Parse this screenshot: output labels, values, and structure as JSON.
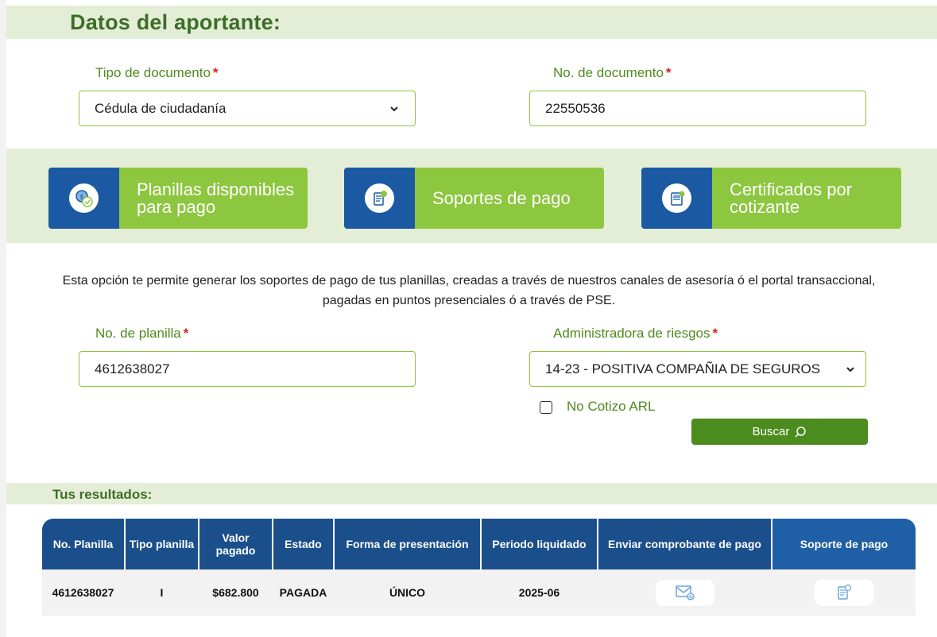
{
  "section_title": "Datos del aportante:",
  "doc_type": {
    "label": "Tipo de documento",
    "required": "*",
    "value": "Cédula de ciudadanía"
  },
  "doc_number": {
    "label": "No. de documento",
    "required": "*",
    "value": "22550536"
  },
  "options": [
    {
      "label": "Planillas disponibles para pago",
      "icon": "money-check-icon"
    },
    {
      "label": "Soportes de pago",
      "icon": "receipt-icon"
    },
    {
      "label": "Certificados por cotizante",
      "icon": "certificate-icon"
    }
  ],
  "description": "Esta opción te permite generar los soportes de pago de tus planillas, creadas a través de nuestros canales de asesoría ó el portal transaccional, pagadas en puntos presenciales ó a través de PSE.",
  "planilla": {
    "label": "No. de planilla",
    "required": "*",
    "value": "4612638027"
  },
  "arl": {
    "label": "Administradora de riesgos",
    "required": "*",
    "value": "14-23 - POSITIVA COMPAÑIA DE SEGUROS"
  },
  "no_cotizo": {
    "label": "No Cotizo ARL",
    "checked": false
  },
  "search_button": "Buscar",
  "results_title": "Tus resultados:",
  "table": {
    "headers": [
      "No. Planilla",
      "Tipo planilla",
      "Valor pagado",
      "Estado",
      "Forma de presentación",
      "Periodo liquidado",
      "Enviar comprobante de pago",
      "Soporte de pago"
    ],
    "rows": [
      {
        "planilla": "4612638027",
        "tipo": "I",
        "valor": "$682.800",
        "estado": "PAGADA",
        "forma": "ÚNICO",
        "periodo": "2025-06",
        "enviar_icon": "email-icon",
        "soporte_icon": "receipt-icon"
      }
    ]
  },
  "colors": {
    "green": "#8dc63f",
    "dark_green": "#4c8c1e",
    "blue": "#1b5aa2",
    "header_blue": "#1b4f8c",
    "required": "#e01e1e"
  }
}
